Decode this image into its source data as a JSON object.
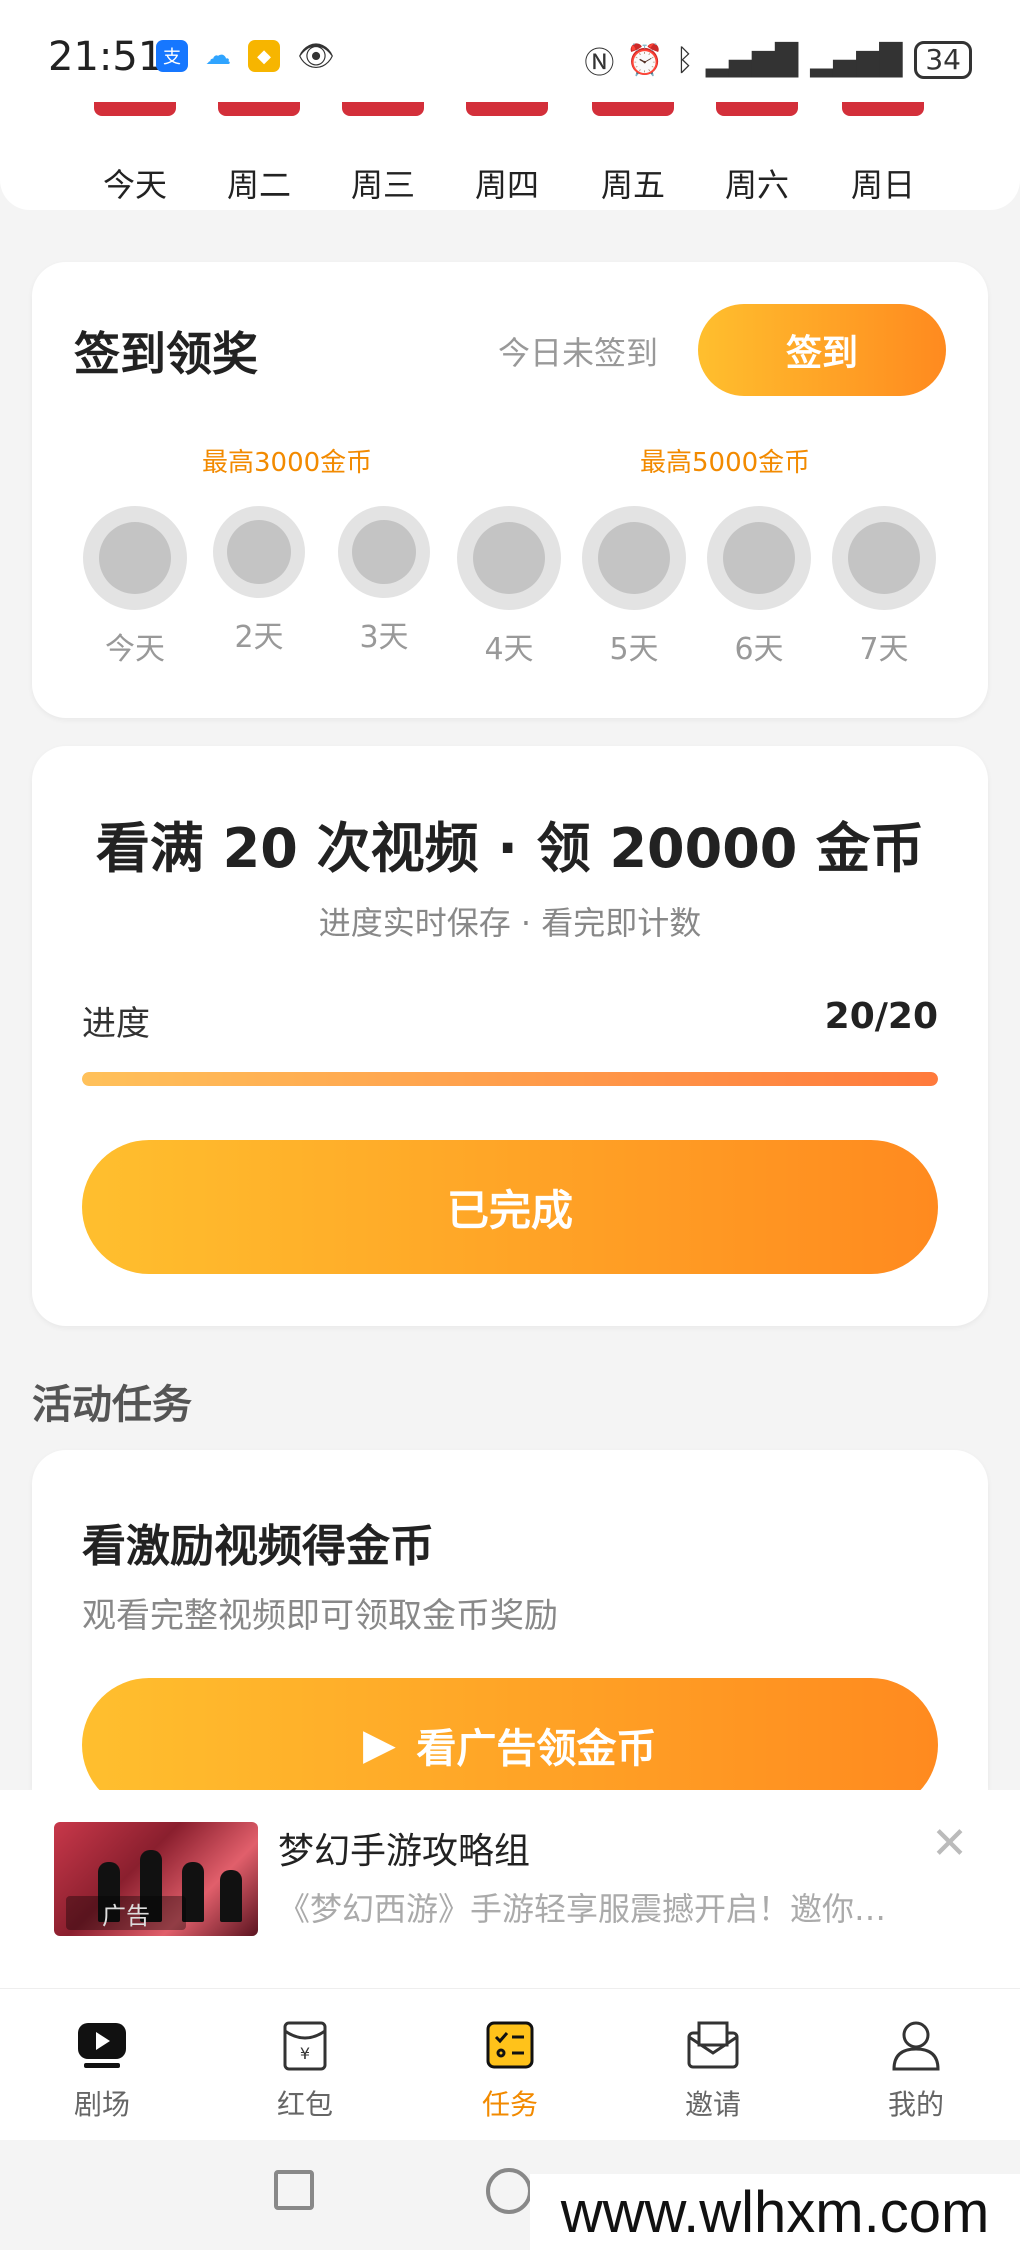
{
  "status_bar": {
    "time": "21:51",
    "battery": "34"
  },
  "week": [
    "今天",
    "周二",
    "周三",
    "周四",
    "周五",
    "周六",
    "周日"
  ],
  "signin": {
    "title": "签到领奖",
    "status": "今日未签到",
    "button": "签到",
    "max_left": "最高3000金币",
    "max_right": "最高5000金币",
    "days": [
      "今天",
      "2天",
      "3天",
      "4天",
      "5天",
      "6天",
      "7天"
    ]
  },
  "video": {
    "title": "看满 20 次视频 · 领 20000 金币",
    "subtitle": "进度实时保存 · 看完即计数",
    "progress_label": "进度",
    "progress_count": "20/20",
    "progress_fraction": 1.0,
    "button": "已完成"
  },
  "section_title": "活动任务",
  "task": {
    "title": "看激励视频得金币",
    "desc": "观看完整视频即可领取金币奖励",
    "button": "看广告领金币"
  },
  "ad": {
    "title": "梦幻手游攻略组",
    "desc": "《梦幻西游》手游轻享服震撼开启！邀你…",
    "tag": "广告"
  },
  "nav": [
    {
      "label": "剧场",
      "icon": "theater-icon"
    },
    {
      "label": "红包",
      "icon": "red-packet-icon"
    },
    {
      "label": "任务",
      "icon": "task-icon",
      "active": true
    },
    {
      "label": "邀请",
      "icon": "invite-icon"
    },
    {
      "label": "我的",
      "icon": "profile-icon"
    }
  ],
  "watermark": "www.wlhxm.com",
  "colors": {
    "accent": "#ff8a1f",
    "accent_light": "#ffbf2e",
    "active_nav": "#f28a00",
    "week_bar": "#d32f3a"
  }
}
